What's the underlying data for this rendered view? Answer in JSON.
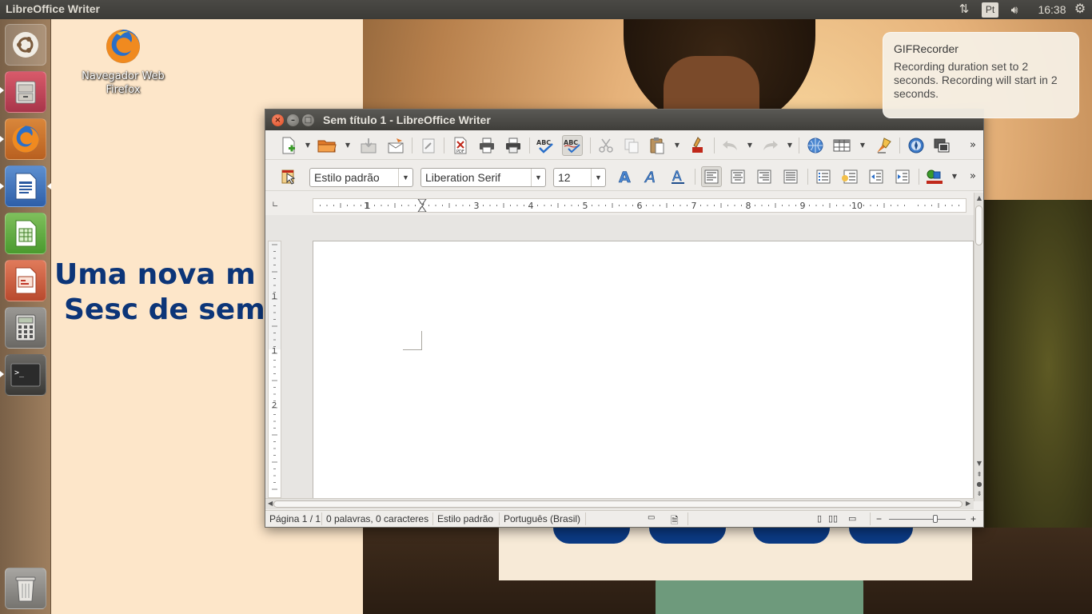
{
  "top_panel": {
    "app_title": "LibreOffice Writer",
    "keyboard_layout": "Pt",
    "clock": "16:38",
    "icons": [
      "network-icon",
      "keyboard-icon",
      "volume-icon",
      "session-gear-icon"
    ]
  },
  "launcher": {
    "items": [
      "dash-home",
      "files",
      "firefox",
      "libreoffice-writer",
      "libreoffice-calc",
      "libreoffice-impress",
      "calculator",
      "terminal",
      "trash"
    ]
  },
  "desktop": {
    "firefox_label_line1": "Navegador Web",
    "firefox_label_line2": "Firefox",
    "wallpaper_line1": "Uma nova m",
    "wallpaper_line2": "Sesc de sem"
  },
  "notification": {
    "title": "GIFRecorder",
    "body": "Recording duration set to 2 seconds. Recording will start in 2 seconds."
  },
  "writer": {
    "title": "Sem título 1 - LibreOffice Writer",
    "paragraph_style": "Estilo padrão",
    "font_name": "Liberation Serif",
    "font_size": "12",
    "ruler_numbers": [
      "1",
      "1",
      "2",
      "3",
      "4",
      "5",
      "6",
      "7",
      "8",
      "9",
      "10"
    ],
    "vruler_numbers": [
      "1",
      "1",
      "2"
    ],
    "status": {
      "page": "Página 1 / 1",
      "words": "0 palavras, 0 caracteres",
      "style": "Estilo padrão",
      "language": "Português (Brasil)"
    },
    "zoom_level": 0.6
  },
  "colors": {
    "panel": "#3c3b37",
    "close_button": "#df4a20",
    "wallpaper_text": "#0c3578",
    "notification_bg": "#f5f0e6"
  }
}
